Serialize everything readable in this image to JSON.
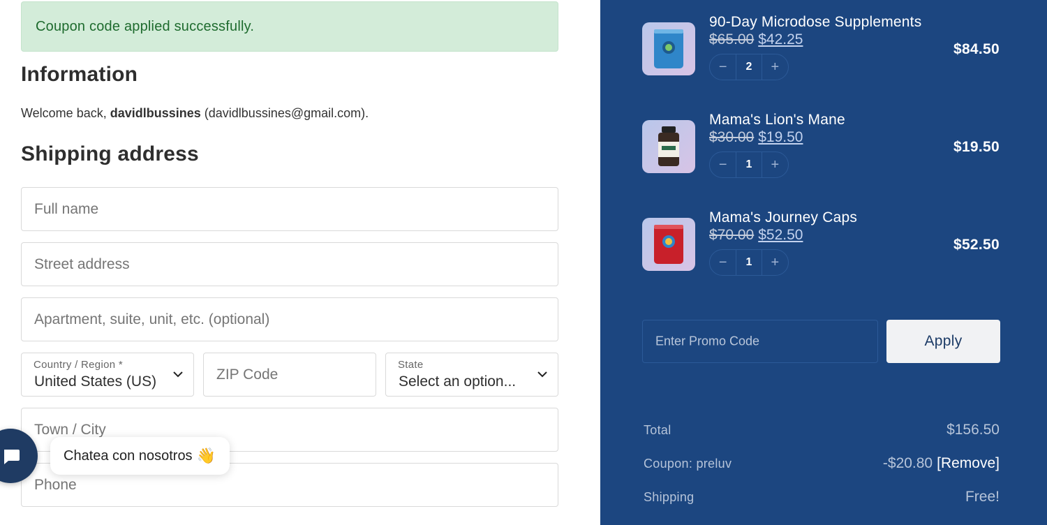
{
  "notice": {
    "text": "Coupon code applied successfully."
  },
  "information": {
    "title": "Information",
    "welcome_prefix": "Welcome back, ",
    "username": "davidlbussines",
    "email_text": " (davidlbussines@gmail.com)."
  },
  "shipping": {
    "title": "Shipping address",
    "full_name_placeholder": "Full name",
    "street_placeholder": "Street address",
    "apartment_placeholder": "Apartment, suite, unit, etc. (optional)",
    "country_label": "Country / Region *",
    "country_value": "United States (US)",
    "zip_placeholder": "ZIP Code",
    "state_label": "State",
    "state_value": "Select an option...",
    "city_placeholder": "Town / City",
    "phone_placeholder": "Phone"
  },
  "chat": {
    "label": "Chatea con nosotros",
    "emoji": "👋"
  },
  "cart": {
    "items": [
      {
        "name": "90-Day Microdose Supplements",
        "old_price": "$65.00",
        "new_price": "$42.25",
        "qty": "2",
        "total": "$84.50",
        "thumb_color": "#2f86c9"
      },
      {
        "name": "Mama's Lion's Mane",
        "old_price": "$30.00",
        "new_price": "$19.50",
        "qty": "1",
        "total": "$19.50",
        "thumb_color": "#3a2a22"
      },
      {
        "name": "Mama's Journey Caps",
        "old_price": "$70.00",
        "new_price": "$52.50",
        "qty": "1",
        "total": "$52.50",
        "thumb_color": "#c8202a"
      }
    ],
    "minus": "−",
    "plus": "+",
    "promo_placeholder": "Enter Promo Code",
    "apply_label": "Apply",
    "total_label": "Total",
    "total_value": "$156.50",
    "coupon_label": "Coupon: preluv",
    "coupon_value": "-$20.80",
    "coupon_remove": "[Remove]",
    "shipping_label": "Shipping",
    "shipping_value": "Free!"
  },
  "colors": {
    "panel_bg": "#1c4680",
    "notice_bg": "#d3ecd9",
    "notice_text": "#1e6b2e",
    "apply_bg": "#f1f2f4"
  }
}
